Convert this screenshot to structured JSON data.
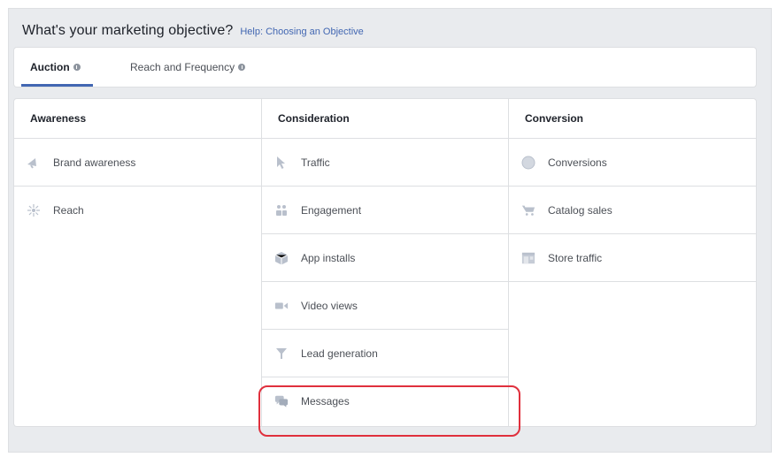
{
  "header": {
    "title": "What's your marketing objective?",
    "help_link": "Help: Choosing an Objective"
  },
  "tabs": [
    {
      "label": "Auction",
      "active": true
    },
    {
      "label": "Reach and Frequency",
      "active": false
    }
  ],
  "columns": [
    {
      "heading": "Awareness",
      "items": [
        {
          "label": "Brand awareness",
          "icon": "megaphone-icon"
        },
        {
          "label": "Reach",
          "icon": "reach-icon"
        }
      ]
    },
    {
      "heading": "Consideration",
      "items": [
        {
          "label": "Traffic",
          "icon": "cursor-icon"
        },
        {
          "label": "Engagement",
          "icon": "people-icon"
        },
        {
          "label": "App installs",
          "icon": "box-icon"
        },
        {
          "label": "Video views",
          "icon": "video-camera-icon"
        },
        {
          "label": "Lead generation",
          "icon": "funnel-icon"
        },
        {
          "label": "Messages",
          "icon": "chat-bubbles-icon"
        }
      ]
    },
    {
      "heading": "Conversion",
      "items": [
        {
          "label": "Conversions",
          "icon": "globe-icon"
        },
        {
          "label": "Catalog sales",
          "icon": "cart-icon"
        },
        {
          "label": "Store traffic",
          "icon": "store-icon"
        }
      ]
    }
  ],
  "colors": {
    "accent": "#4267b2",
    "icon": "#b9c0cc",
    "highlight": "#e0303d"
  }
}
